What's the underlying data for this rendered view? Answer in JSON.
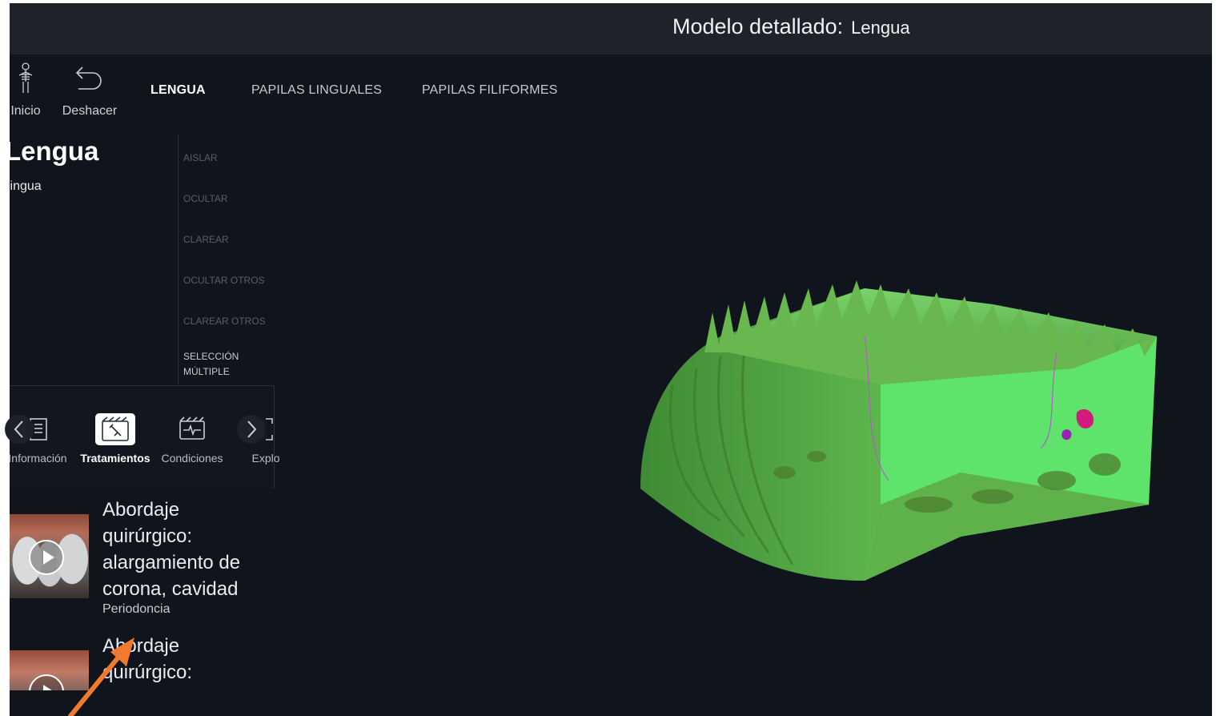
{
  "header": {
    "title_label": "Modelo detallado:",
    "title_value": "Lengua"
  },
  "toolbar": {
    "home_label": "Inicio",
    "undo_label": "Deshacer"
  },
  "nav_tabs": [
    {
      "label": "LENGUA",
      "active": true
    },
    {
      "label": "PAPILAS LINGUALES",
      "active": false
    },
    {
      "label": "PAPILAS FILIFORMES",
      "active": false
    }
  ],
  "panel": {
    "title": "Lengua",
    "subtitle": "lingua"
  },
  "actions": [
    "AISLAR",
    "OCULTAR",
    "CLAREAR",
    "OCULTAR OTROS",
    "CLAREAR OTROS",
    "SELECCIÓN MÚLTIPLE"
  ],
  "section_tabs": [
    {
      "label": "Información",
      "icon": "book-icon",
      "active": false
    },
    {
      "label": "Tratamientos",
      "icon": "syringe-clapperboard-icon",
      "active": true
    },
    {
      "label": "Condiciones",
      "icon": "heartbeat-clapperboard-icon",
      "active": false
    },
    {
      "label": "Explo",
      "icon": "explode-icon",
      "active": false
    }
  ],
  "treatments": [
    {
      "title": "Abordaje quirúrgico: alargamiento de corona, cavidad",
      "category": "Periodoncia"
    },
    {
      "title": "Abordaje quirúrgico:",
      "category": ""
    }
  ],
  "colors": {
    "background": "#10151d",
    "header": "#1e2229",
    "model_green": "#5fd35a",
    "annotation_arrow": "#f07a2e"
  }
}
